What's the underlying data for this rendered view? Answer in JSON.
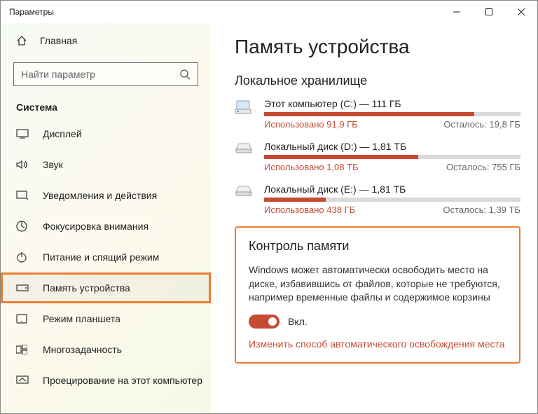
{
  "window": {
    "title": "Параметры"
  },
  "sidebar": {
    "home": "Главная",
    "search_placeholder": "Найти параметр",
    "category": "Система",
    "items": [
      {
        "label": "Дисплей"
      },
      {
        "label": "Звук"
      },
      {
        "label": "Уведомления и действия"
      },
      {
        "label": "Фокусировка внимания"
      },
      {
        "label": "Питание и спящий режим"
      },
      {
        "label": "Память устройства"
      },
      {
        "label": "Режим планшета"
      },
      {
        "label": "Многозадачность"
      },
      {
        "label": "Проецирование на этот компьютер"
      }
    ]
  },
  "main": {
    "title": "Память устройства",
    "local_storage_title": "Локальное хранилище",
    "drives": [
      {
        "name": "Этот компьютер (C:) — 111 ГБ",
        "used": "Использовано 91,9 ГБ",
        "free": "Осталось: 19,8 ГБ",
        "fill": 82
      },
      {
        "name": "Локальный диск (D:) — 1,81 ТБ",
        "used": "Использовано 1,08 ТБ",
        "free": "Осталось: 755 ГБ",
        "fill": 60
      },
      {
        "name": "Локальный диск (E:) — 1,81 ТБ",
        "used": "Использовано 438 ГБ",
        "free": "Осталось: 1,39 ТБ",
        "fill": 24
      }
    ],
    "sense": {
      "title": "Контроль памяти",
      "desc": "Windows может автоматически освободить место на диске, избавившись от файлов, которые не требуются, например временные файлы и содержимое корзины",
      "toggle_label": "Вкл.",
      "link": "Изменить способ автоматического освобождения места"
    }
  }
}
